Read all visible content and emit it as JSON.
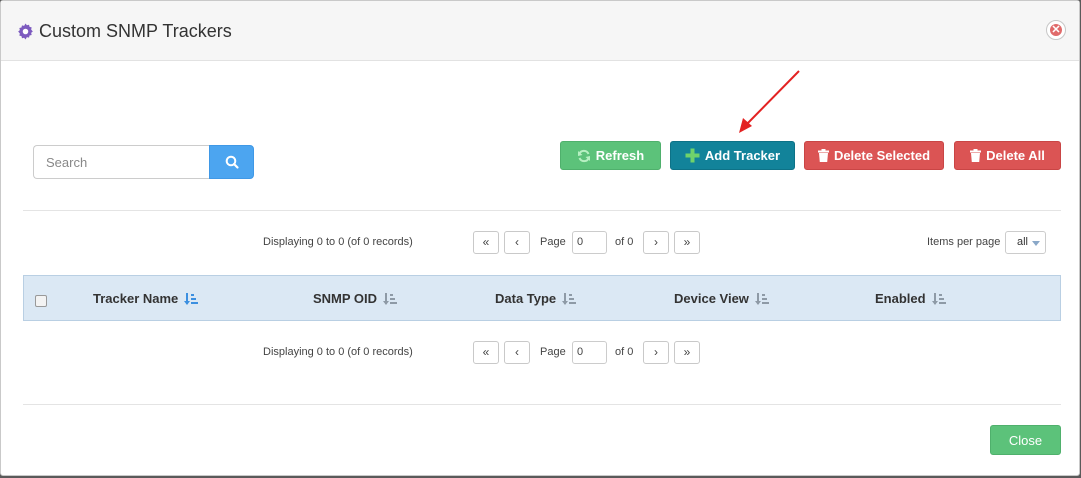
{
  "dialog": {
    "title": "Custom SNMP Trackers",
    "title_icon": "gear-icon",
    "close_icon": "close-circle-icon"
  },
  "search": {
    "placeholder": "Search",
    "value": "",
    "icon": "search-icon"
  },
  "toolbar": {
    "refresh_label": "Refresh",
    "add_label": "Add Tracker",
    "delete_selected_label": "Delete Selected",
    "delete_all_label": "Delete All"
  },
  "pager_top": {
    "display_text": "Displaying 0 to 0 (of 0 records)",
    "first": "«",
    "prev": "‹",
    "page_label": "Page",
    "page_value": "0",
    "of_text": "of 0",
    "next": "›",
    "last": "»",
    "items_per_page_label": "Items per page",
    "items_per_page_value": "all"
  },
  "table": {
    "columns": [
      "Tracker Name",
      "SNMP OID",
      "Data Type",
      "Device View",
      "Enabled"
    ]
  },
  "pager_bottom": {
    "display_text": "Displaying 0 to 0 (of 0 records)",
    "first": "«",
    "prev": "‹",
    "page_label": "Page",
    "page_value": "0",
    "of_text": "of 0",
    "next": "›",
    "last": "»"
  },
  "footer": {
    "close_label": "Close"
  },
  "colors": {
    "primary": "#12839a",
    "success": "#5cc27a",
    "danger": "#db5454",
    "search": "#4ca5f0",
    "header_bg": "#dbe8f4"
  }
}
